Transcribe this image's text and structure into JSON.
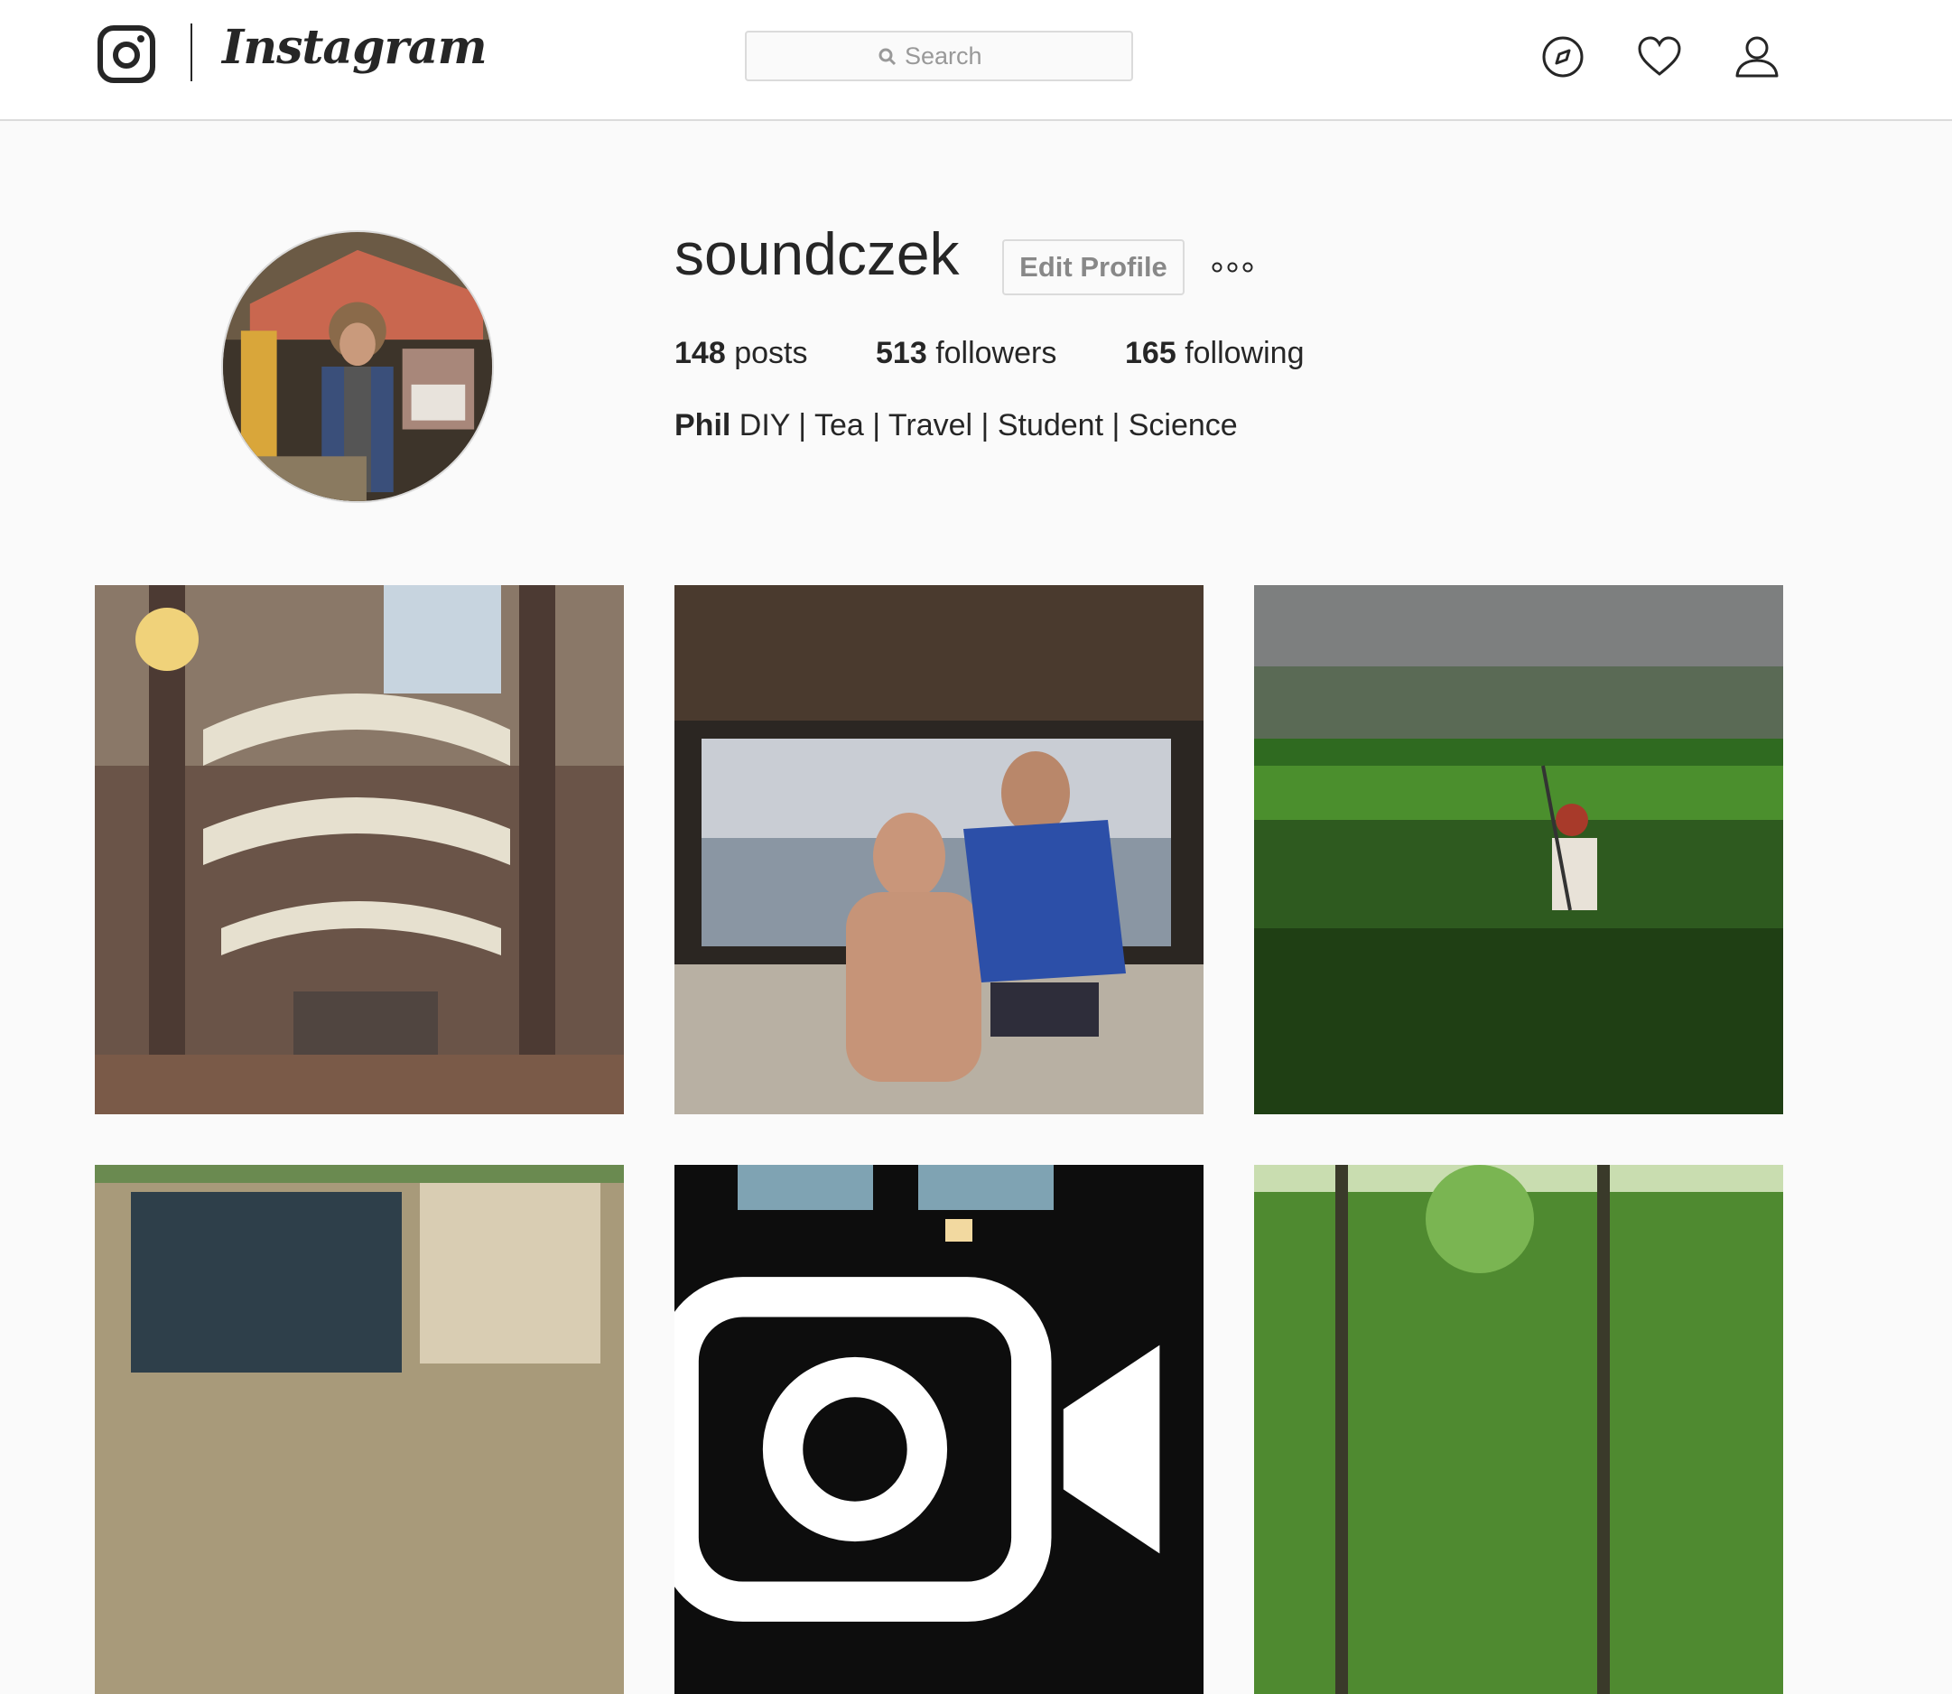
{
  "header": {
    "wordmark": "Instagram",
    "search_placeholder": "Search",
    "icons": [
      "instagram-logo-icon",
      "search-icon",
      "compass-icon",
      "heart-icon",
      "user-icon"
    ]
  },
  "profile": {
    "username": "soundczek",
    "edit_button_label": "Edit Profile",
    "stats": {
      "posts_count": "148",
      "posts_label": "posts",
      "followers_count": "513",
      "followers_label": "followers",
      "following_count": "165",
      "following_label": "following"
    },
    "bio_name": "Phil",
    "bio_text": "DIY | Tea | Travel | Student | Science"
  },
  "grid": {
    "posts": [
      {
        "type": "photo",
        "subject": "ornate-staircase-hall"
      },
      {
        "type": "photo",
        "subject": "couple-on-boat"
      },
      {
        "type": "photo",
        "subject": "rice-field-farmer"
      },
      {
        "type": "photo",
        "subject": "chalkboard-sign"
      },
      {
        "type": "video",
        "subject": "dark-interior-window"
      },
      {
        "type": "photo",
        "subject": "forest-trees"
      }
    ]
  }
}
